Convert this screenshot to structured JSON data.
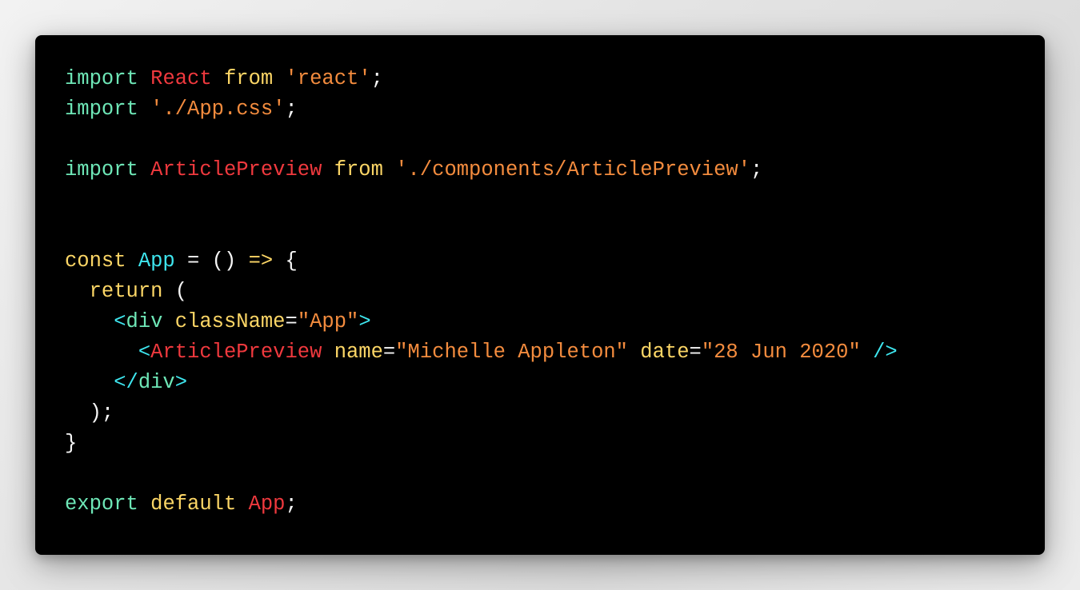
{
  "colors": {
    "background": "#000000",
    "keyword_green": "#6ee7b7",
    "keyword_yellow": "#fcd666",
    "identifier_red": "#f0393e",
    "string_orange": "#f48c3e",
    "identifier_cyan": "#3ee6ef",
    "punctuation": "#f5f5f5"
  },
  "code": {
    "lines": [
      [
        {
          "t": "import",
          "c": "kw-green"
        },
        {
          "t": " ",
          "c": "punc"
        },
        {
          "t": "React",
          "c": "id-red"
        },
        {
          "t": " ",
          "c": "punc"
        },
        {
          "t": "from",
          "c": "kw-yellow"
        },
        {
          "t": " ",
          "c": "punc"
        },
        {
          "t": "'react'",
          "c": "str"
        },
        {
          "t": ";",
          "c": "punc"
        }
      ],
      [
        {
          "t": "import",
          "c": "kw-green"
        },
        {
          "t": " ",
          "c": "punc"
        },
        {
          "t": "'./App.css'",
          "c": "str"
        },
        {
          "t": ";",
          "c": "punc"
        }
      ],
      [],
      [
        {
          "t": "import",
          "c": "kw-green"
        },
        {
          "t": " ",
          "c": "punc"
        },
        {
          "t": "ArticlePreview",
          "c": "id-red"
        },
        {
          "t": " ",
          "c": "punc"
        },
        {
          "t": "from",
          "c": "kw-yellow"
        },
        {
          "t": " ",
          "c": "punc"
        },
        {
          "t": "'./components/ArticlePreview'",
          "c": "str"
        },
        {
          "t": ";",
          "c": "punc"
        }
      ],
      [],
      [],
      [
        {
          "t": "const",
          "c": "kw-yellow"
        },
        {
          "t": " ",
          "c": "punc"
        },
        {
          "t": "App",
          "c": "id-cyan"
        },
        {
          "t": " = () ",
          "c": "punc"
        },
        {
          "t": "=>",
          "c": "kw-yellow"
        },
        {
          "t": " {",
          "c": "punc"
        }
      ],
      [
        {
          "t": "  ",
          "c": "punc"
        },
        {
          "t": "return",
          "c": "kw-yellow"
        },
        {
          "t": " (",
          "c": "punc"
        }
      ],
      [
        {
          "t": "    ",
          "c": "punc"
        },
        {
          "t": "<",
          "c": "tag-br"
        },
        {
          "t": "div",
          "c": "tag-name"
        },
        {
          "t": " ",
          "c": "punc"
        },
        {
          "t": "className",
          "c": "kw-yellow"
        },
        {
          "t": "=",
          "c": "punc"
        },
        {
          "t": "\"App\"",
          "c": "str"
        },
        {
          "t": ">",
          "c": "tag-br"
        }
      ],
      [
        {
          "t": "      ",
          "c": "punc"
        },
        {
          "t": "<",
          "c": "tag-br"
        },
        {
          "t": "ArticlePreview",
          "c": "id-red"
        },
        {
          "t": " ",
          "c": "punc"
        },
        {
          "t": "name",
          "c": "kw-yellow"
        },
        {
          "t": "=",
          "c": "punc"
        },
        {
          "t": "\"Michelle Appleton\"",
          "c": "str"
        },
        {
          "t": " ",
          "c": "punc"
        },
        {
          "t": "date",
          "c": "kw-yellow"
        },
        {
          "t": "=",
          "c": "punc"
        },
        {
          "t": "\"28 Jun 2020\"",
          "c": "str"
        },
        {
          "t": " ",
          "c": "punc"
        },
        {
          "t": "/>",
          "c": "tag-br"
        }
      ],
      [
        {
          "t": "    ",
          "c": "punc"
        },
        {
          "t": "</",
          "c": "tag-br"
        },
        {
          "t": "div",
          "c": "tag-name"
        },
        {
          "t": ">",
          "c": "tag-br"
        }
      ],
      [
        {
          "t": "  );",
          "c": "punc"
        }
      ],
      [
        {
          "t": "}",
          "c": "punc"
        }
      ],
      [],
      [
        {
          "t": "export",
          "c": "kw-green"
        },
        {
          "t": " ",
          "c": "punc"
        },
        {
          "t": "default",
          "c": "kw-yellow"
        },
        {
          "t": " ",
          "c": "punc"
        },
        {
          "t": "App",
          "c": "id-red"
        },
        {
          "t": ";",
          "c": "punc"
        }
      ]
    ]
  }
}
